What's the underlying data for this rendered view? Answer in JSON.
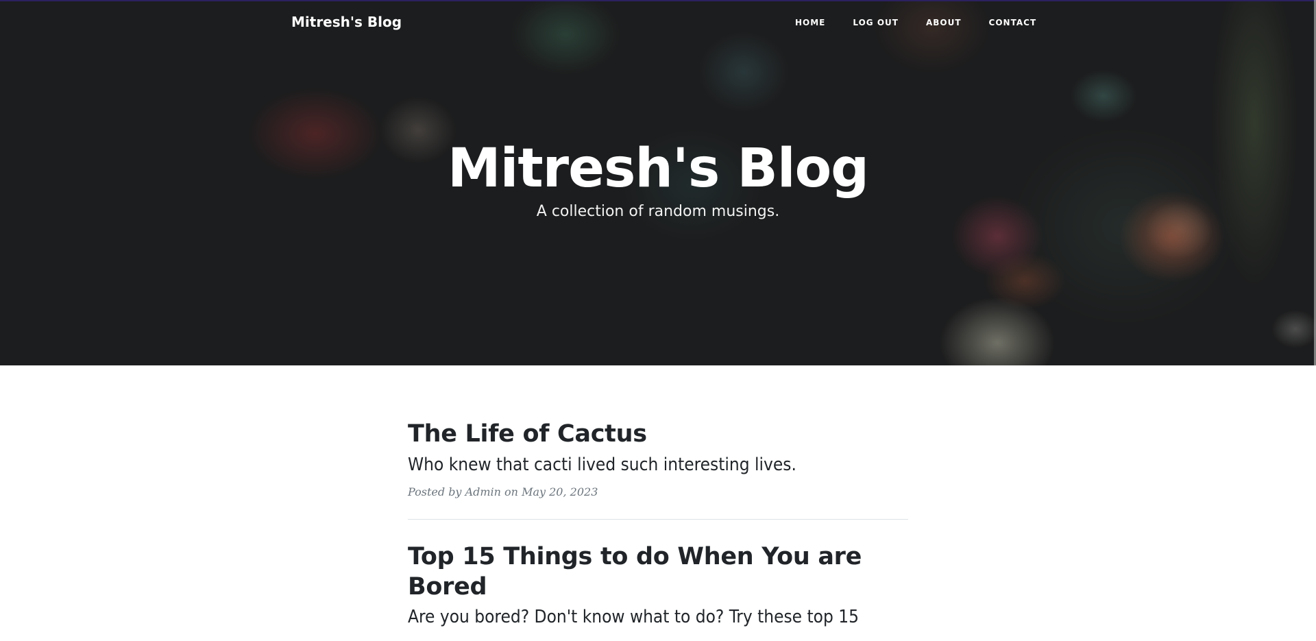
{
  "navbar": {
    "brand": "Mitresh's Blog",
    "links": [
      {
        "label": "HOME"
      },
      {
        "label": "LOG OUT"
      },
      {
        "label": "ABOUT"
      },
      {
        "label": "CONTACT"
      }
    ]
  },
  "hero": {
    "title": "Mitresh's Blog",
    "subtitle": "A collection of random musings."
  },
  "posts": [
    {
      "title": "The Life of Cactus",
      "subtitle": "Who knew that cacti lived such interesting lives.",
      "meta_prefix": "Posted by",
      "author": "Admin",
      "meta_on": "on",
      "date": "May 20, 2023"
    },
    {
      "title": "Top 15 Things to do When You are Bored",
      "subtitle": "Are you bored? Don't know what to do? Try these top 15"
    }
  ],
  "colors": {
    "text": "#212529",
    "meta": "#6c757d",
    "divider": "#dee2e6",
    "hero_text": "#ffffff"
  }
}
